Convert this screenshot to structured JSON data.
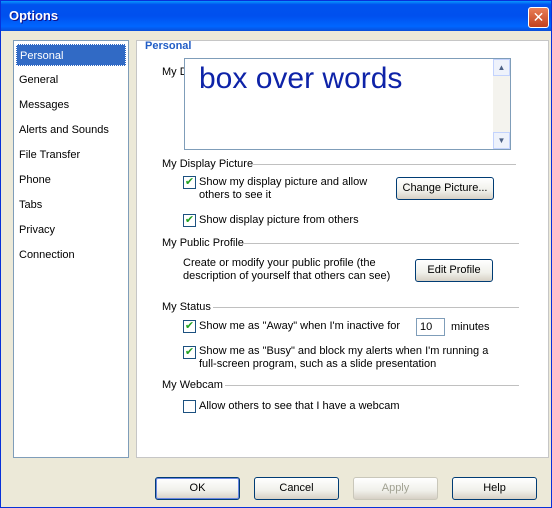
{
  "window": {
    "title": "Options",
    "close_glyph": "✕"
  },
  "nav": {
    "items": [
      {
        "label": "Personal",
        "selected": true
      },
      {
        "label": "General"
      },
      {
        "label": "Messages"
      },
      {
        "label": "Alerts and Sounds"
      },
      {
        "label": "File Transfer"
      },
      {
        "label": "Phone"
      },
      {
        "label": "Tabs"
      },
      {
        "label": "Privacy"
      },
      {
        "label": "Connection"
      }
    ]
  },
  "personal": {
    "heading": "Personal",
    "message_label": "My D",
    "message_text": "box over words",
    "display_picture": {
      "label": "My Display Picture",
      "show_mine": "Show my display picture and allow others to see it",
      "show_mine_checked": true,
      "show_others": "Show display picture from others",
      "show_others_checked": true,
      "change_button": "Change Picture..."
    },
    "public_profile": {
      "label": "My Public Profile",
      "description": "Create or modify your public profile (the description of yourself that others can see)",
      "edit_button": "Edit Profile"
    },
    "status": {
      "label": "My Status",
      "away_prefix": "Show me as \"Away\" when I'm inactive for",
      "away_minutes": "10",
      "away_suffix": "minutes",
      "away_checked": true,
      "busy": "Show me as \"Busy\" and block my alerts when I'm running a full-screen program, such as a slide presentation",
      "busy_checked": true
    },
    "webcam": {
      "label": "My Webcam",
      "allow": "Allow others to see that I have a webcam",
      "allow_checked": false
    }
  },
  "footer": {
    "ok": "OK",
    "cancel": "Cancel",
    "apply": "Apply",
    "help": "Help"
  },
  "icons": {
    "scroll_up": "up-arrow-icon",
    "scroll_down": "down-arrow-icon",
    "check": "✔"
  }
}
